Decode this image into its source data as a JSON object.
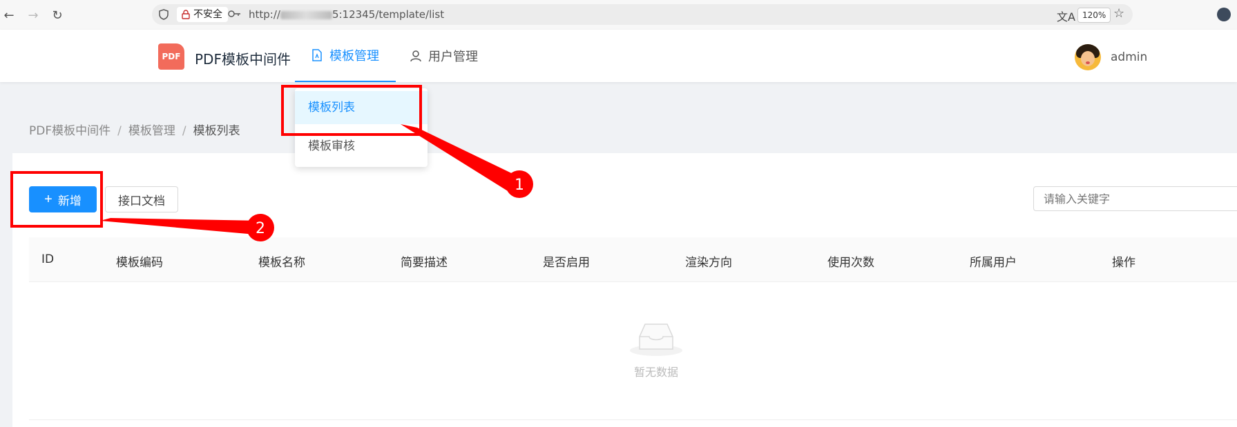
{
  "browser": {
    "insecure_label": "不安全",
    "url_prefix": "http://",
    "url_suffix": "5:12345/template/list",
    "zoom": "120%"
  },
  "app": {
    "title": "PDF模板中间件",
    "logo_text": "PDF"
  },
  "menu": {
    "template_mgmt": "模板管理",
    "user_mgmt": "用户管理"
  },
  "dropdown": {
    "items": [
      {
        "label": "模板列表"
      },
      {
        "label": "模板审核"
      }
    ]
  },
  "user": {
    "name": "admin"
  },
  "breadcrumb": [
    "PDF模板中间件",
    "模板管理",
    "模板列表"
  ],
  "toolbar": {
    "add_label": "新增",
    "docs_label": "接口文档",
    "search_placeholder": "请输入关键字"
  },
  "table": {
    "columns": [
      "ID",
      "模板编码",
      "模板名称",
      "简要描述",
      "是否启用",
      "渲染方向",
      "使用次数",
      "所属用户",
      "操作"
    ],
    "empty_text": "暂无数据"
  },
  "annotations": {
    "badge_1": "1",
    "badge_2": "2",
    "color": "#ff0000"
  }
}
